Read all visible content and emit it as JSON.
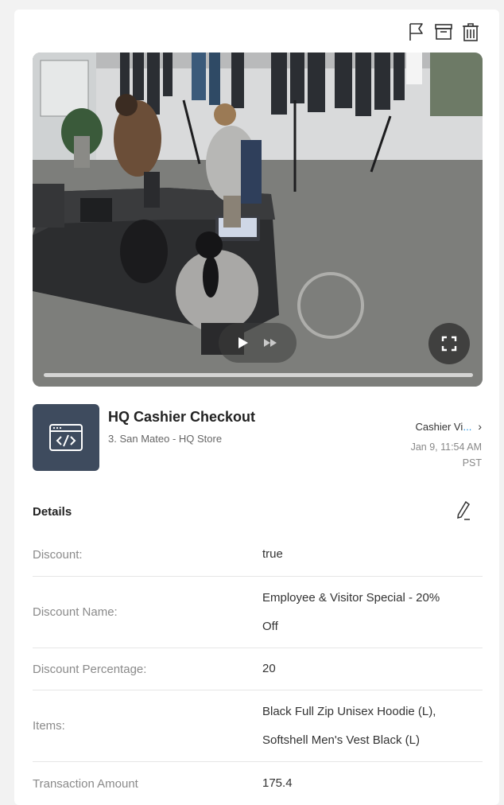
{
  "actions": {
    "flag_icon": "flag-icon",
    "archive_icon": "archive-icon",
    "delete_icon": "trash-icon"
  },
  "video": {
    "play_icon": "play-icon",
    "forward_icon": "fast-forward-icon",
    "fullscreen_icon": "fullscreen-icon",
    "progress": 0.0
  },
  "event": {
    "title": "HQ Cashier Checkout",
    "subtitle": "3. San Mateo - HQ Store",
    "camera_name": "Cashier Vie",
    "camera_ellipsis": "...",
    "timestamp_line1": "Jan 9, 11:54 AM",
    "timestamp_line2": "PST"
  },
  "details": {
    "heading": "Details",
    "rows": [
      {
        "label": "Discount:",
        "value": "true"
      },
      {
        "label": "Discount Name:",
        "value_lines": [
          "Employee & Visitor Special - 20%",
          "Off"
        ]
      },
      {
        "label": "Discount Percentage:",
        "value": "20"
      },
      {
        "label": "Items:",
        "value_lines": [
          "Black Full Zip Unisex Hoodie (L),",
          "Softshell Men's Vest Black (L)"
        ]
      },
      {
        "label": "Transaction Amount",
        "value": "175.4"
      }
    ]
  },
  "colors": {
    "app_icon_bg": "#3e4b5e",
    "link_accent": "#1a8fe3"
  }
}
